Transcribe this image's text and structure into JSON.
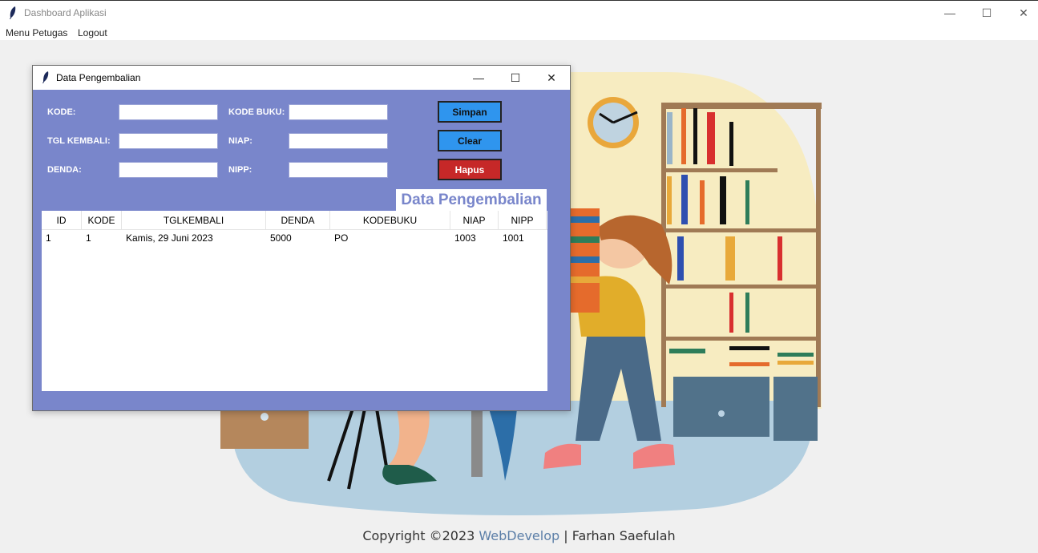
{
  "window": {
    "title": "Dashboard Aplikasi",
    "controls": {
      "minimize": "—",
      "maximize": "☐",
      "close": "✕"
    }
  },
  "menu": {
    "items": [
      "Menu Petugas",
      "Logout"
    ]
  },
  "footer": {
    "prefix": "Copyright ©2023 ",
    "link": "WebDevelop",
    "suffix": " | Farhan Saefulah"
  },
  "dialog": {
    "title": "Data Pengembalian",
    "controls": {
      "minimize": "—",
      "maximize": "☐",
      "close": "✕"
    },
    "form": {
      "kode_label": "KODE:",
      "tgl_label": "TGL KEMBALI:",
      "denda_label": "DENDA:",
      "kode_buku_label": "KODE BUKU:",
      "niap_label": "NIAP:",
      "nipp_label": "NIPP:",
      "kode_value": "",
      "tgl_value": "",
      "denda_value": "",
      "kode_buku_value": "",
      "niap_value": "",
      "nipp_value": ""
    },
    "buttons": {
      "simpan": "Simpan",
      "clear": "Clear",
      "hapus": "Hapus"
    },
    "heading": "Data Pengembalian",
    "table": {
      "columns": [
        "ID",
        "KODE",
        "TGLKEMBALI",
        "DENDA",
        "KODEBUKU",
        "NIAP",
        "NIPP"
      ],
      "rows": [
        [
          "1",
          "1",
          "Kamis, 29 Juni 2023",
          "5000",
          "PO",
          "1003",
          "1001"
        ]
      ]
    }
  },
  "colors": {
    "dialog_bg": "#7986cb",
    "primary_button": "#2f95ee",
    "danger_button": "#c62828",
    "link": "#5c7fa8"
  }
}
